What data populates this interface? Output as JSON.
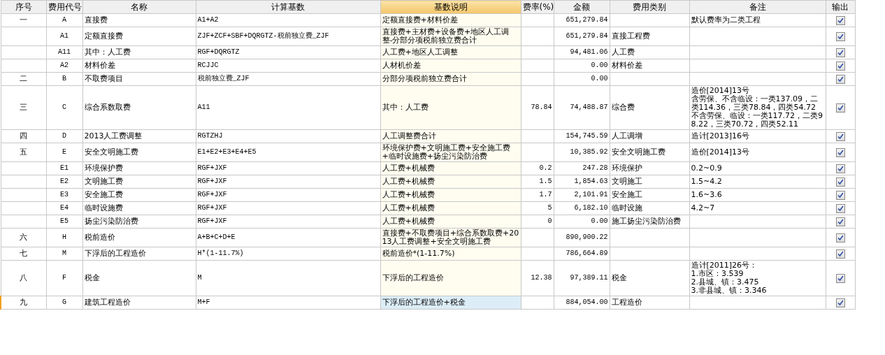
{
  "columns": [
    {
      "label": "序号",
      "selected": false
    },
    {
      "label": "费用代号",
      "selected": false
    },
    {
      "label": "名称",
      "selected": false
    },
    {
      "label": "计算基数",
      "selected": false
    },
    {
      "label": "基数说明",
      "selected": true
    },
    {
      "label": "费率(%)",
      "selected": false
    },
    {
      "label": "金额",
      "selected": false
    },
    {
      "label": "费用类别",
      "selected": false
    },
    {
      "label": "备注",
      "selected": false
    },
    {
      "label": "输出",
      "selected": false
    }
  ],
  "rows": [
    {
      "no": "一",
      "code": "A",
      "name": "直接费",
      "base": "A1+A2",
      "base_desc": "定额直接费+材料价差",
      "amount": "651,279.84",
      "remarks": "默认费率为二类工程",
      "output": true,
      "selected": false
    },
    {
      "code": "A1",
      "name": "定额直接费",
      "base": "ZJF+ZCF+SBF+DQRGTZ-税前独立费_ZJF",
      "base_desc": "直接费+主材费+设备费+地区人工调整-分部分项税前独立费合计",
      "amount": "651,279.84",
      "category": "直接工程费",
      "output": true,
      "selected": false
    },
    {
      "code": "A11",
      "name": "其中：人工费",
      "base": "RGF+DQRGTZ",
      "base_desc": "人工费+地区人工调整",
      "amount": "94,481.06",
      "category": "人工费",
      "output": true,
      "selected": false
    },
    {
      "code": "A2",
      "name": "材料价差",
      "base": "RCJJC",
      "base_desc": "人材机价差",
      "amount": "0.00",
      "category": "材料价差",
      "output": true,
      "selected": false
    },
    {
      "no": "二",
      "code": "B",
      "name": "不取费项目",
      "base": "税前独立费_ZJF",
      "base_desc": "分部分项税前独立费合计",
      "amount": "0.00",
      "output": true,
      "selected": false
    },
    {
      "no": "三",
      "code": "C",
      "name": "综合系数取费",
      "base": "A11",
      "base_desc": "其中：人工费",
      "rate": "78.84",
      "amount": "74,488.87",
      "category": "综合费",
      "remarks": [
        "造价[2014]13号",
        "含劳保、不含临设：一类137.09，二类114.36，三类78.84，四类54.72",
        "不含劳保、临设：一类117.72，二类98.22，三类70.72，四类52.11"
      ],
      "output": true,
      "selected": false
    },
    {
      "no": "四",
      "code": "D",
      "name": "2013人工费调整",
      "base": "RGTZHJ",
      "base_desc": "人工调整费合计",
      "amount": "154,745.59",
      "category": "人工调增",
      "remarks": "造计[2013]16号",
      "output": true,
      "selected": false
    },
    {
      "no": "五",
      "code": "E",
      "name": "安全文明施工费",
      "base": "E1+E2+E3+E4+E5",
      "base_desc": "环境保护费+文明施工费+安全施工费+临时设施费+扬尘污染防治费",
      "amount": "10,385.92",
      "category": "安全文明施工费",
      "remarks": "造价[2014]13号",
      "output": true,
      "selected": false
    },
    {
      "code": "E1",
      "name": "环境保护费",
      "base": "RGF+JXF",
      "base_desc": "人工费+机械费",
      "rate": "0.2",
      "amount": "247.28",
      "category": "环境保护",
      "remarks": "0.2~0.9",
      "output": true,
      "selected": false
    },
    {
      "code": "E2",
      "name": "文明施工费",
      "base": "RGF+JXF",
      "base_desc": "人工费+机械费",
      "rate": "1.5",
      "amount": "1,854.63",
      "category": "文明施工",
      "remarks": "1.5~4.2",
      "output": true,
      "selected": false
    },
    {
      "code": "E3",
      "name": "安全施工费",
      "base": "RGF+JXF",
      "base_desc": "人工费+机械费",
      "rate": "1.7",
      "amount": "2,101.91",
      "category": "安全施工",
      "remarks": "1.6~3.6",
      "output": true,
      "selected": false
    },
    {
      "code": "E4",
      "name": "临时设施费",
      "base": "RGF+JXF",
      "base_desc": "人工费+机械费",
      "rate": "5",
      "amount": "6,182.10",
      "category": "临时设施",
      "remarks": "4.2~7",
      "output": true,
      "selected": false
    },
    {
      "code": "E5",
      "name": "扬尘污染防治费",
      "base": "RGF+JXF",
      "base_desc": "人工费+机械费",
      "rate": "0",
      "amount": "0.00",
      "category": "施工扬尘污染防治费",
      "output": true,
      "selected": false
    },
    {
      "no": "六",
      "code": "H",
      "name": "税前造价",
      "base": "A+B+C+D+E",
      "base_desc": "直接费+不取费项目+综合系数取费+2013人工费调整+安全文明施工费",
      "amount": "890,900.22",
      "output": true,
      "selected": false
    },
    {
      "no": "七",
      "code": "M",
      "name": "下浮后的工程造价",
      "base": "H*(1-11.7%)",
      "base_desc": "税前造价*(1-11.7%)",
      "amount": "786,664.89",
      "output": true,
      "selected": false
    },
    {
      "no": "八",
      "code": "F",
      "name": "税金",
      "base": "M",
      "base_desc": "下浮后的工程造价",
      "rate": "12.38",
      "amount": "97,389.11",
      "category": "税金",
      "remarks": [
        "造计[2011]26号：",
        "1.市区：3.539",
        "2.县城、镇：3.475",
        "3.非县城、镇：3.346"
      ],
      "output": true,
      "selected": false
    },
    {
      "no": "九",
      "code": "G",
      "name": "建筑工程造价",
      "base": "M+F",
      "base_desc": "下浮后的工程造价+税金",
      "amount": "884,054.00",
      "category": "工程造价",
      "output": true,
      "selected": true
    }
  ]
}
